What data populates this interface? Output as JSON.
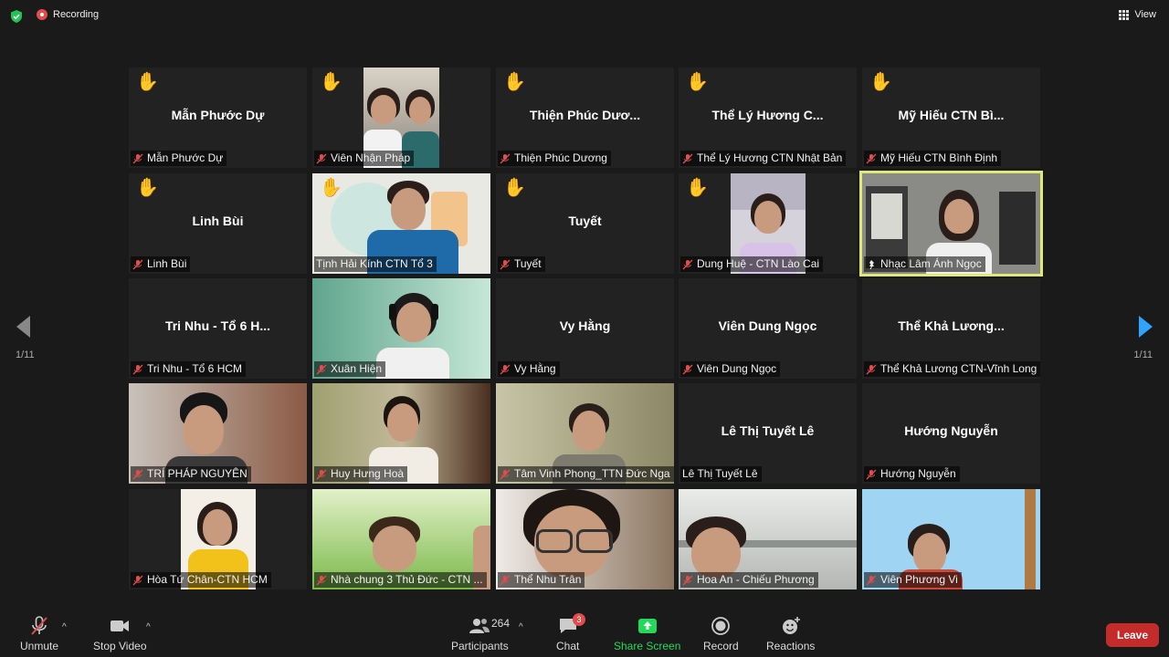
{
  "top": {
    "recording_label": "Recording",
    "view_label": "View"
  },
  "pager": {
    "left": "1/11",
    "right": "1/11"
  },
  "tiles": [
    {
      "big": "Mẫn Phước Dự",
      "label": "Mẫn Phước Dự"
    },
    {
      "big": "",
      "label": "Viên Nhận Pháp"
    },
    {
      "big": "Thiện Phúc Dươ...",
      "label": "Thiện Phúc Dương"
    },
    {
      "big": "Thể Lý Hương C...",
      "label": "Thể Lý Hương CTN Nhật Bản"
    },
    {
      "big": "Mỹ Hiếu CTN Bì...",
      "label": "Mỹ Hiếu CTN Bình Định"
    },
    {
      "big": "Linh Bùi",
      "label": "Linh Bùi"
    },
    {
      "big": "",
      "label": "Tịnh Hải Kính CTN Tổ 3"
    },
    {
      "big": "Tuyết",
      "label": "Tuyết"
    },
    {
      "big": "",
      "label": "Dung Huệ - CTN Lào Cai"
    },
    {
      "big": "",
      "label": "Nhạc Lâm Ánh Ngọc"
    },
    {
      "big": "Tri Nhu - Tổ 6 H...",
      "label": "Tri Nhu - Tổ 6 HCM"
    },
    {
      "big": "",
      "label": "Xuân Hiện"
    },
    {
      "big": "Vy Hằng",
      "label": "Vy Hằng"
    },
    {
      "big": "Viên Dung Ngọc",
      "label": "Viên Dung Ngọc"
    },
    {
      "big": "Thể Khả Lương...",
      "label": "Thể Khả Lương CTN-Vĩnh Long"
    },
    {
      "big": "",
      "label": "TRÍ PHÁP NGUYÊN"
    },
    {
      "big": "",
      "label": "Huy Hưng Hoà"
    },
    {
      "big": "",
      "label": "Tâm Vinh Phong_TTN Đức Nga"
    },
    {
      "big": "Lê Thị Tuyết Lê",
      "label": "Lê Thị Tuyết Lê"
    },
    {
      "big": "Hướng Nguyễn",
      "label": "Hướng Nguyễn"
    },
    {
      "big": "",
      "label": "Hòa Tứ Chân-CTN HCM"
    },
    {
      "big": "",
      "label": "Nhà chung 3 Thủ Đức - CTN ..."
    },
    {
      "big": "",
      "label": "Thể Nhu Trân"
    },
    {
      "big": "",
      "label": "Hoa An - Chiếu Phương"
    },
    {
      "big": "",
      "label": "Viên Phương Vi"
    }
  ],
  "toolbar": {
    "unmute": "Unmute",
    "stop_video": "Stop Video",
    "participants": "Participants",
    "participants_count": "264",
    "chat": "Chat",
    "chat_badge": "3",
    "share": "Share Screen",
    "record": "Record",
    "reactions": "Reactions",
    "leave": "Leave"
  },
  "colors": {
    "accent": "#2ea4ff",
    "share_green": "#23d959",
    "leave": "#c42b2b",
    "active_border": "#dfe97a"
  }
}
